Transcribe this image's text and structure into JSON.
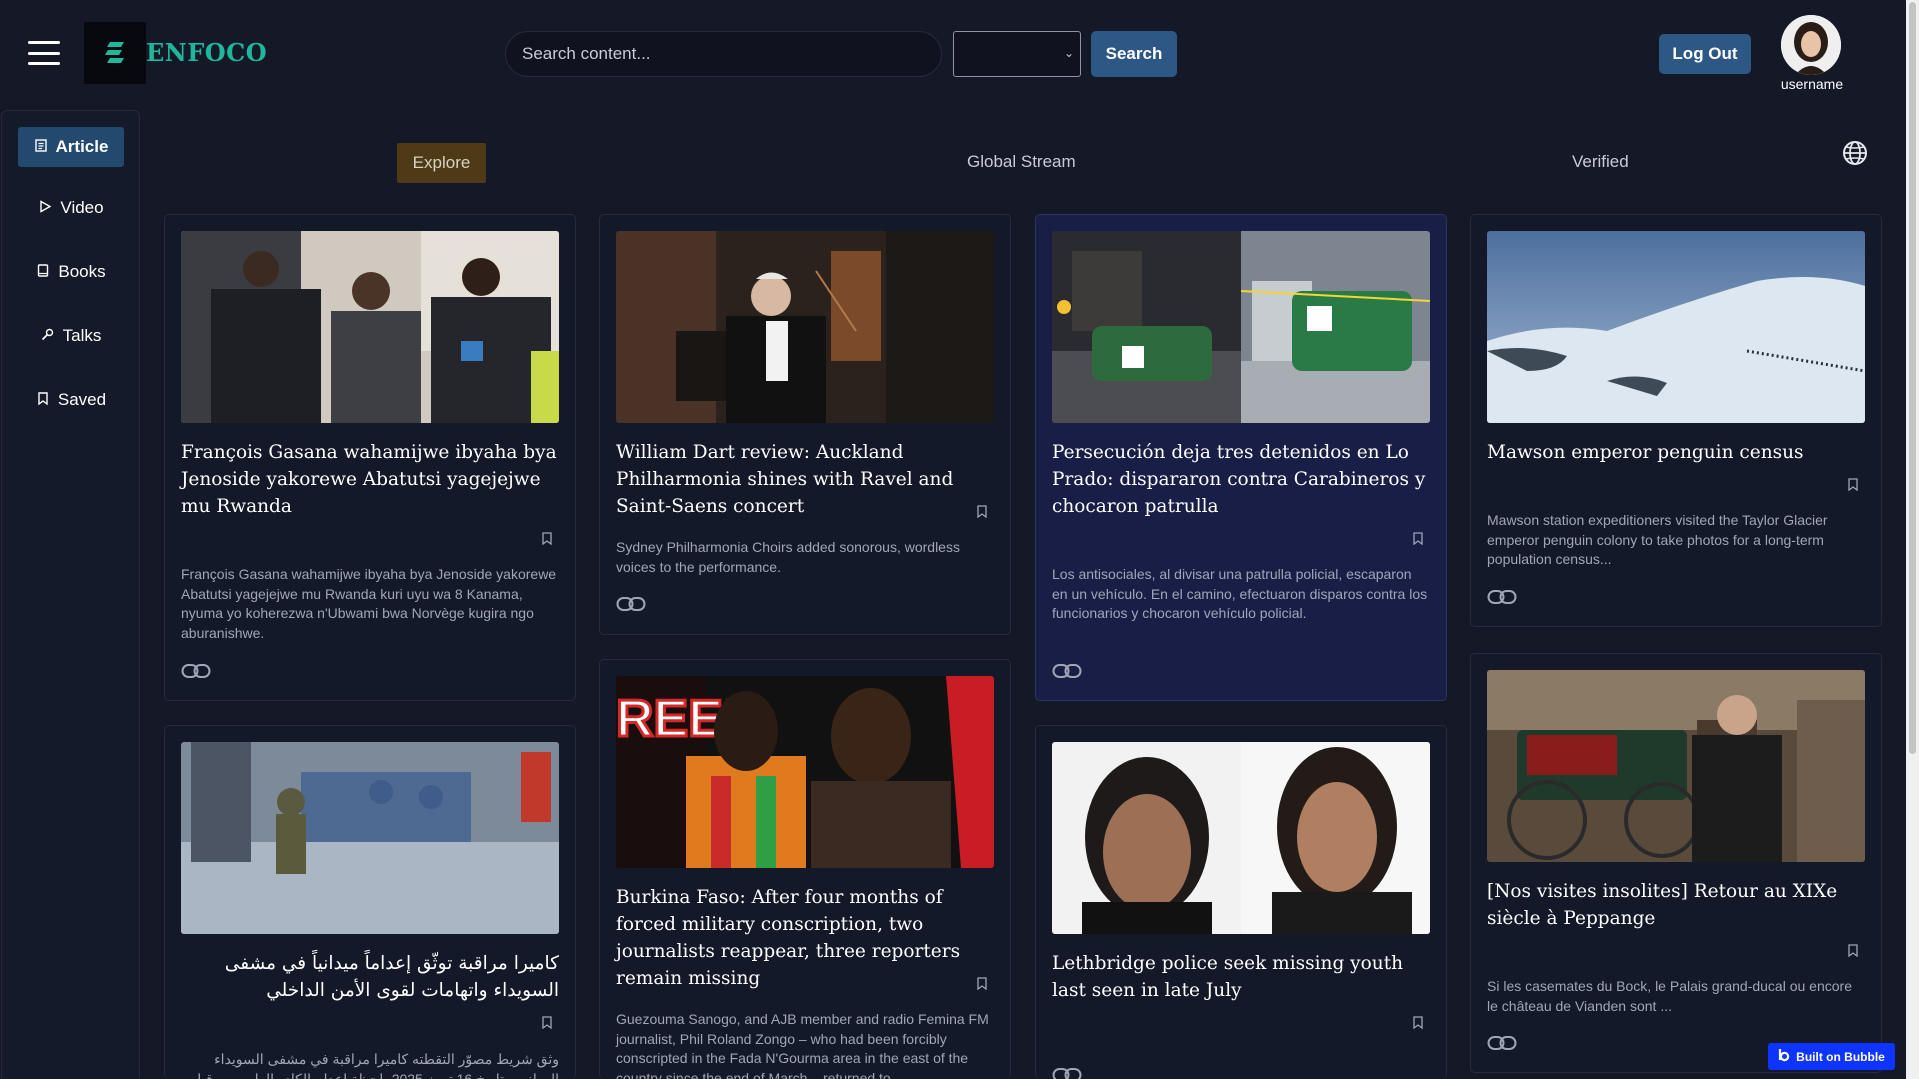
{
  "header": {
    "logo_text": "ENFOCO",
    "search_placeholder": "Search content...",
    "search_button": "Search",
    "logout_button": "Log Out",
    "username": "username"
  },
  "sidebar": {
    "items": [
      {
        "label": "Article",
        "icon": "document-icon",
        "active": true
      },
      {
        "label": "Video",
        "icon": "play-icon"
      },
      {
        "label": "Books",
        "icon": "book-icon"
      },
      {
        "label": "Talks",
        "icon": "microphone-icon"
      },
      {
        "label": "Saved",
        "icon": "bookmark-icon"
      }
    ]
  },
  "tabs": {
    "explore": "Explore",
    "global": "Global Stream",
    "verified": "Verified"
  },
  "cards": [
    {
      "title": "François Gasana wahamijwe ibyaha bya Jenoside yakorewe Abatutsi yagejejwe mu Rwanda",
      "desc": "François Gasana wahamijwe ibyaha bya Jenoside yakorewe Abatutsi yagejejwe mu Rwanda kuri uyu wa 8 Kanama, nyuma yo koherezwa n'Ubwami bwa Norvège kugira ngo aburanishwe."
    },
    {
      "title": "William Dart review: Auckland Philharmonia shines with Ravel and Saint-Saens concert",
      "desc": "Sydney Philharmonia Choirs added sonorous, wordless voices to the performance."
    },
    {
      "title": "Persecución deja tres detenidos en Lo Prado: dispararon contra Carabineros y chocaron patrulla",
      "desc": "Los antisociales, al divisar una patrulla policial, escaparon en un vehículo. En el camino, efectuaron disparos contra los funcionarios y chocaron vehículo policial."
    },
    {
      "title": "Mawson emperor penguin census",
      "desc": "Mawson station expeditioners visited the Taylor Glacier emperor penguin colony to take photos for a long-term population census..."
    },
    {
      "title": "كاميرا مراقبة توثّق إعداماً ميدانياً في مشفى السويداء واتهامات لقوى الأمن الداخلي",
      "desc": "وثق شريط مصوّر التقطته كاميرا مراقبة في مشفى السويداء الوطني، بتاريخ 16 تموز 2025، لحظة إعدام الكادر الطبي من قبل عناصر يُعتقد أنهم تابعون لقوى الأمن الداخلي"
    },
    {
      "title": "Burkina Faso: After four months of forced military conscription, two journalists reappear, three reporters remain missing",
      "desc": "Guezouma Sanogo, and AJB member and radio Femina FM journalist, Phil Roland Zongo – who had been forcibly conscripted in the Fada N'Gourma area in the east of the country since the end of March – returned to"
    },
    {
      "title": "Lethbridge police seek missing youth last seen in late July",
      "desc": ""
    },
    {
      "title": "[Nos visites insolites] Retour au XIXe siècle à Peppange",
      "desc": "Si les casemates du Bock, le Palais grand-ducal ou encore le château de Vianden sont ..."
    }
  ],
  "badge": {
    "label": "Built on Bubble"
  }
}
